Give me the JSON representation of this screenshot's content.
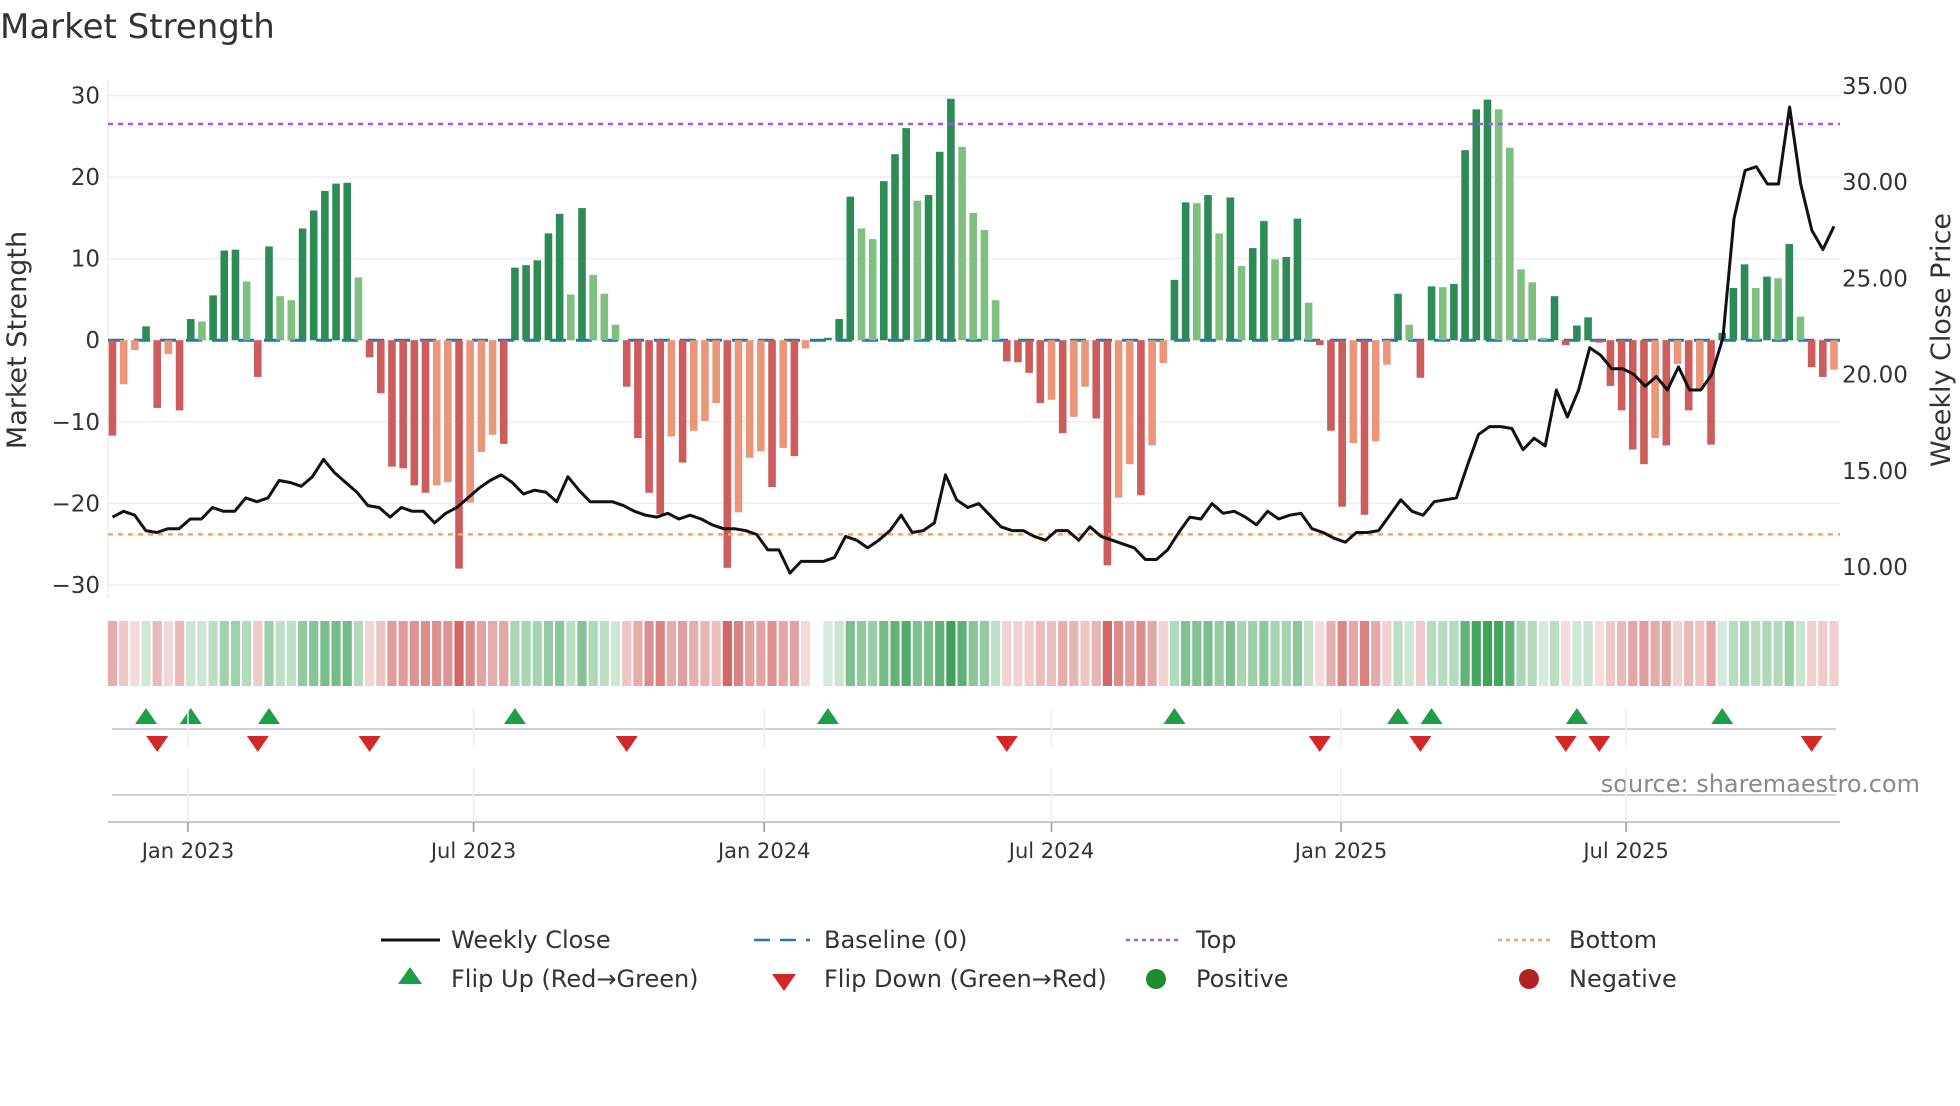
{
  "title": "Market Strength",
  "source": "source: sharemaestro.com",
  "legend": {
    "weekly_close": "Weekly Close",
    "baseline": "Baseline (0)",
    "top": "Top",
    "bottom": "Bottom",
    "flip_up": "Flip Up (Red→Green)",
    "flip_down": "Flip Down (Green→Red)",
    "positive": "Positive",
    "negative": "Negative"
  },
  "colors": {
    "strong_up": "#2e8b57",
    "weak_up": "#7fbf7f",
    "strong_down": "#cd5c5c",
    "weak_down": "#e9967a",
    "close_line": "#111111",
    "baseline": "#1f77b4",
    "top": "#9b5de5",
    "bottom": "#f4a460",
    "flip_up": "#1e9e4a",
    "flip_down": "#d62728",
    "positive": "#1e8c2e",
    "negative": "#b22222"
  },
  "chart_data": {
    "type": "bar",
    "title": "Market Strength",
    "ylabel": "Market Strength",
    "y2label": "Weekly Close Price",
    "ylim": [
      -31.6,
      31.9
    ],
    "y2lim": [
      8.4,
      35.3
    ],
    "yticks": [
      "30",
      "20",
      "10",
      "0",
      "−10",
      "−20",
      "−30"
    ],
    "ytick_values": [
      30,
      20,
      10,
      0,
      -10,
      -20,
      -30
    ],
    "y2ticks": [
      "35.00",
      "30.00",
      "25.00",
      "20.00",
      "15.00",
      "10.00"
    ],
    "y2tick_values": [
      35,
      30,
      25,
      20,
      15,
      10
    ],
    "xticks": [
      {
        "label": "Jan 2023",
        "week": 6.75
      },
      {
        "label": "Jul 2023",
        "week": 32.3
      },
      {
        "label": "Jan 2024",
        "week": 58.3
      },
      {
        "label": "Jul 2024",
        "week": 84.0
      },
      {
        "label": "Jan 2025",
        "week": 109.9
      },
      {
        "label": "Jul 2025",
        "week": 135.4
      }
    ],
    "top": 26.5,
    "bottom": -23.8,
    "baseline": 0,
    "strength": [
      -11.7,
      -5.4,
      -1.2,
      1.7,
      -8.3,
      -1.7,
      -8.6,
      2.6,
      2.3,
      5.5,
      11.0,
      11.1,
      7.2,
      -4.5,
      11.5,
      5.4,
      4.9,
      13.7,
      15.9,
      18.3,
      19.2,
      19.3,
      7.7,
      -2.1,
      -6.5,
      -15.5,
      -15.7,
      -17.8,
      -18.7,
      -17.8,
      -17.4,
      -28.0,
      -19.9,
      -13.7,
      -11.6,
      -12.7,
      8.9,
      9.2,
      9.8,
      13.1,
      15.5,
      5.6,
      16.2,
      8.0,
      5.7,
      1.9,
      -5.7,
      -12.0,
      -18.7,
      -21.3,
      -11.8,
      -15.0,
      -11.1,
      -9.9,
      -7.7,
      -27.9,
      -21.1,
      -14.4,
      -13.6,
      -18.0,
      -13.2,
      -14.2,
      -1.0,
      null,
      0.3,
      2.6,
      17.6,
      13.7,
      12.4,
      19.5,
      22.8,
      26.0,
      17.1,
      17.8,
      23.1,
      29.6,
      23.7,
      15.6,
      13.5,
      4.9,
      -2.6,
      -2.7,
      -4.0,
      -7.7,
      -7.3,
      -11.4,
      -9.4,
      -5.7,
      -9.6,
      -27.6,
      -19.3,
      -15.2,
      -19.0,
      -12.9,
      -2.8,
      7.4,
      16.9,
      16.8,
      17.8,
      13.1,
      17.5,
      9.1,
      11.3,
      14.6,
      9.9,
      10.2,
      14.9,
      4.6,
      -0.6,
      -11.1,
      -20.4,
      -12.6,
      -21.4,
      -12.4,
      -3.0,
      5.7,
      1.9,
      -4.6,
      6.6,
      6.5,
      6.9,
      23.3,
      28.3,
      29.5,
      28.3,
      23.6,
      8.7,
      7.1,
      0.3,
      5.4,
      -0.6,
      1.8,
      2.8,
      -0.3,
      -5.6,
      -8.6,
      -13.4,
      -15.2,
      -12.0,
      -12.9,
      -2.9,
      -8.6,
      -6.1,
      -12.8,
      0.9,
      6.4,
      9.3,
      6.4,
      7.8,
      7.6,
      11.8,
      2.9,
      -3.3,
      -4.5,
      -3.6
    ],
    "weekly_close": [
      12.6,
      12.9,
      12.7,
      11.9,
      11.8,
      12.0,
      12.0,
      12.5,
      12.5,
      13.1,
      12.9,
      12.9,
      13.6,
      13.4,
      13.6,
      14.5,
      14.4,
      14.2,
      14.7,
      15.6,
      14.9,
      14.4,
      13.9,
      13.2,
      13.1,
      12.6,
      13.1,
      12.9,
      12.9,
      12.3,
      12.8,
      13.1,
      13.6,
      14.1,
      14.5,
      14.8,
      14.4,
      13.8,
      14.0,
      13.9,
      13.4,
      14.7,
      14.0,
      13.4,
      13.4,
      13.4,
      13.2,
      12.9,
      12.7,
      12.6,
      12.8,
      12.5,
      12.7,
      12.5,
      12.2,
      12.0,
      12.0,
      11.9,
      11.7,
      10.9,
      10.9,
      9.7,
      10.3,
      10.3,
      10.3,
      10.5,
      11.6,
      11.4,
      11.0,
      11.4,
      11.9,
      12.7,
      11.8,
      11.9,
      12.3,
      14.8,
      13.5,
      13.1,
      13.3,
      12.7,
      12.1,
      11.9,
      11.9,
      11.6,
      11.4,
      11.9,
      11.9,
      11.4,
      12.1,
      11.6,
      11.4,
      11.2,
      11.0,
      10.4,
      10.4,
      10.9,
      11.8,
      12.6,
      12.5,
      13.3,
      12.8,
      12.9,
      12.6,
      12.2,
      12.9,
      12.5,
      12.7,
      12.8,
      12.0,
      11.8,
      11.5,
      11.3,
      11.8,
      11.8,
      11.9,
      12.7,
      13.5,
      12.9,
      12.7,
      13.4,
      13.5,
      13.6,
      15.3,
      16.9,
      17.3,
      17.3,
      17.2,
      16.1,
      16.7,
      16.3,
      19.2,
      17.8,
      19.2,
      21.4,
      21.0,
      20.3,
      20.3,
      20.0,
      19.4,
      19.9,
      19.2,
      20.4,
      19.2,
      19.2,
      20.0,
      21.9,
      28.1,
      30.6,
      30.8,
      29.9,
      29.9,
      33.9,
      29.9,
      27.5,
      26.5,
      27.7
    ],
    "legend_placement": "bottom-center",
    "grid": true
  }
}
